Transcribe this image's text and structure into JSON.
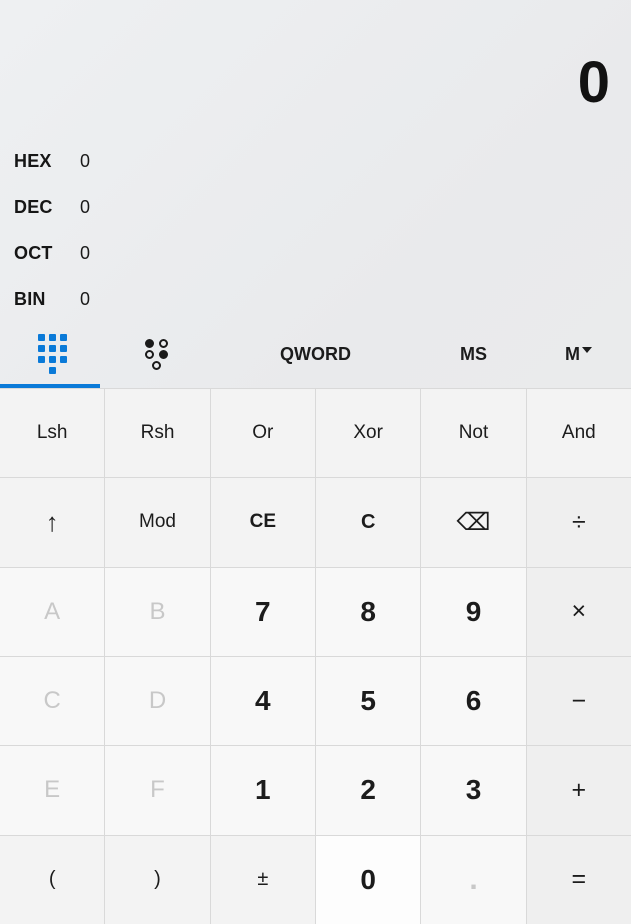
{
  "display": {
    "result": "0",
    "radix_rows": [
      {
        "label": "HEX",
        "value": "0"
      },
      {
        "label": "DEC",
        "value": "0"
      },
      {
        "label": "OCT",
        "value": "0"
      },
      {
        "label": "BIN",
        "value": "0"
      }
    ]
  },
  "optionbar": {
    "keypad_icon": "keypad-dots-icon",
    "bits_icon": "bit-toggle-icon",
    "word_size": "QWORD",
    "memory_store": "MS",
    "memory_label": "M",
    "memory_caret": "chevron-down-icon",
    "accent": "#0a7ad8"
  },
  "keypad": {
    "rows": [
      [
        {
          "label": "Lsh",
          "kind": "fn",
          "name": "left-shift"
        },
        {
          "label": "Rsh",
          "kind": "fn",
          "name": "right-shift"
        },
        {
          "label": "Or",
          "kind": "fn",
          "name": "bitwise-or"
        },
        {
          "label": "Xor",
          "kind": "fn",
          "name": "bitwise-xor"
        },
        {
          "label": "Not",
          "kind": "fn",
          "name": "bitwise-not"
        },
        {
          "label": "And",
          "kind": "fn",
          "name": "bitwise-and"
        }
      ],
      [
        {
          "label": "↑",
          "kind": "fn",
          "name": "shift-up-arrow"
        },
        {
          "label": "Mod",
          "kind": "fn",
          "name": "modulo"
        },
        {
          "label": "CE",
          "kind": "fn",
          "name": "clear-entry",
          "bold": true
        },
        {
          "label": "C",
          "kind": "fn",
          "name": "clear",
          "bold": true
        },
        {
          "label": "⌫",
          "kind": "fn",
          "name": "backspace"
        },
        {
          "label": "÷",
          "kind": "op",
          "name": "divide"
        }
      ],
      [
        {
          "label": "A",
          "kind": "hex",
          "name": "hex-a",
          "disabled": true
        },
        {
          "label": "B",
          "kind": "hex",
          "name": "hex-b",
          "disabled": true
        },
        {
          "label": "7",
          "kind": "num",
          "name": "digit-7"
        },
        {
          "label": "8",
          "kind": "num",
          "name": "digit-8"
        },
        {
          "label": "9",
          "kind": "num",
          "name": "digit-9"
        },
        {
          "label": "×",
          "kind": "op",
          "name": "multiply"
        }
      ],
      [
        {
          "label": "C",
          "kind": "hex",
          "name": "hex-c",
          "disabled": true
        },
        {
          "label": "D",
          "kind": "hex",
          "name": "hex-d",
          "disabled": true
        },
        {
          "label": "4",
          "kind": "num",
          "name": "digit-4"
        },
        {
          "label": "5",
          "kind": "num",
          "name": "digit-5"
        },
        {
          "label": "6",
          "kind": "num",
          "name": "digit-6"
        },
        {
          "label": "−",
          "kind": "op",
          "name": "subtract"
        }
      ],
      [
        {
          "label": "E",
          "kind": "hex",
          "name": "hex-e",
          "disabled": true
        },
        {
          "label": "F",
          "kind": "hex",
          "name": "hex-f",
          "disabled": true
        },
        {
          "label": "1",
          "kind": "num",
          "name": "digit-1"
        },
        {
          "label": "2",
          "kind": "num",
          "name": "digit-2"
        },
        {
          "label": "3",
          "kind": "num",
          "name": "digit-3"
        },
        {
          "label": "+",
          "kind": "op",
          "name": "add"
        }
      ],
      [
        {
          "label": "(",
          "kind": "fn",
          "name": "open-paren"
        },
        {
          "label": ")",
          "kind": "fn",
          "name": "close-paren"
        },
        {
          "label": "±",
          "kind": "fn",
          "name": "negate"
        },
        {
          "label": "0",
          "kind": "num",
          "name": "digit-0",
          "hover": true
        },
        {
          "label": ".",
          "kind": "num",
          "name": "decimal-point",
          "disabled": true
        },
        {
          "label": "=",
          "kind": "op",
          "name": "equals"
        }
      ]
    ]
  }
}
